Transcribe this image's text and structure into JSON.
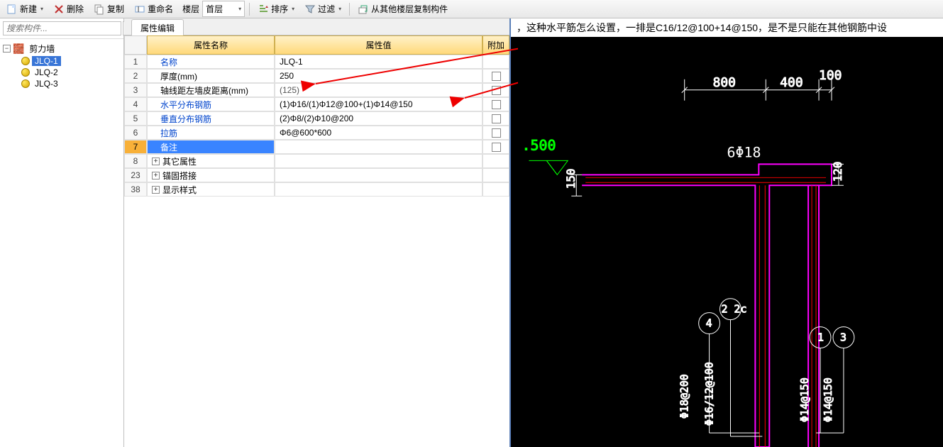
{
  "toolbar": {
    "new_label": "新建",
    "delete_label": "删除",
    "copy_label": "复制",
    "rename_label": "重命名",
    "floor_label": "楼层",
    "floor_value": "首层",
    "sort_label": "排序",
    "filter_label": "过滤",
    "copy_from_label": "从其他楼层复制构件"
  },
  "search": {
    "placeholder": "搜索构件..."
  },
  "tree": {
    "root": "剪力墙",
    "items": [
      {
        "label": "JLQ-1",
        "selected": true
      },
      {
        "label": "JLQ-2",
        "selected": false
      },
      {
        "label": "JLQ-3",
        "selected": false
      }
    ]
  },
  "tabs": {
    "active": "属性编辑"
  },
  "prop": {
    "headers": {
      "name": "属性名称",
      "value": "属性值",
      "extra": "附加"
    },
    "rows": [
      {
        "n": "1",
        "name": "名称",
        "value": "JLQ-1",
        "link": true,
        "indent": true,
        "chk": false,
        "sel": false
      },
      {
        "n": "2",
        "name": "厚度(mm)",
        "value": "250",
        "link": false,
        "indent": true,
        "chk": true,
        "sel": false
      },
      {
        "n": "3",
        "name": "轴线距左墙皮距离(mm)",
        "value": "(125)",
        "link": false,
        "indent": true,
        "chk": true,
        "sel": false
      },
      {
        "n": "4",
        "name": "水平分布钢筋",
        "value": "(1)Φ16/(1)Φ12@100+(1)Φ14@150",
        "link": true,
        "indent": true,
        "chk": true,
        "sel": false
      },
      {
        "n": "5",
        "name": "垂直分布钢筋",
        "value": "(2)Φ8/(2)Φ10@200",
        "link": true,
        "indent": true,
        "chk": true,
        "sel": false
      },
      {
        "n": "6",
        "name": "拉筋",
        "value": "Φ6@600*600",
        "link": true,
        "indent": true,
        "chk": true,
        "sel": false
      },
      {
        "n": "7",
        "name": "备注",
        "value": "",
        "link": false,
        "indent": true,
        "chk": true,
        "sel": true
      },
      {
        "n": "8",
        "name": "其它属性",
        "value": "",
        "link": false,
        "indent": false,
        "chk": false,
        "sel": false,
        "expand": true
      },
      {
        "n": "23",
        "name": "锚固搭接",
        "value": "",
        "link": false,
        "indent": false,
        "chk": false,
        "sel": false,
        "expand": true
      },
      {
        "n": "38",
        "name": "显示样式",
        "value": "",
        "link": false,
        "indent": false,
        "chk": false,
        "sel": false,
        "expand": true
      }
    ]
  },
  "question": {
    "text": "，这种水平筋怎么设置，一排是C16/12@100+14@150，是不是只能在其他钢筋中设"
  },
  "cad": {
    "elev": ".500",
    "dim800": "800",
    "dim400": "400",
    "dim100": "100",
    "dim150": "150",
    "dim120": "120",
    "top_rebar": "6Φ18",
    "callouts": {
      "c1": "Φ18@200",
      "c2": "Φ16/12@100",
      "c3": "Φ14@150",
      "c4": "Φ14@150",
      "b1": "4",
      "b2": "2 2c",
      "b3": "1",
      "b4": "3"
    }
  }
}
